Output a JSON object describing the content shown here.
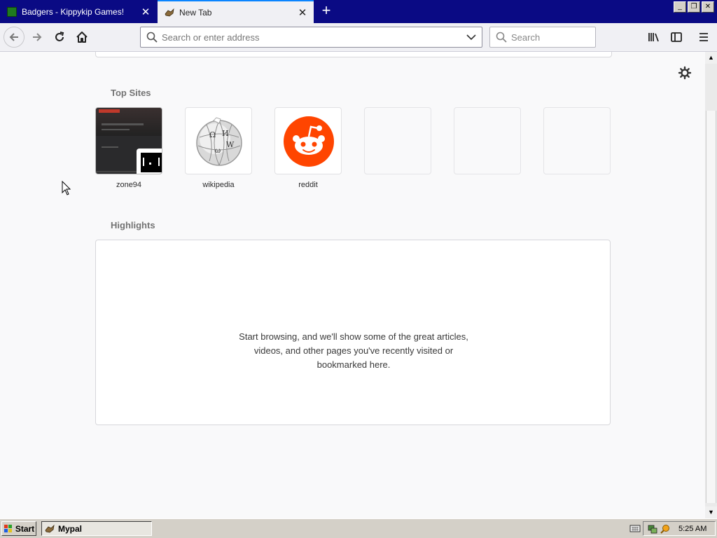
{
  "tabs": [
    {
      "title": "Badgers - Kippykip Games!",
      "active": false,
      "favicon": "green-square-favicon"
    },
    {
      "title": "New Tab",
      "active": true,
      "favicon": "mypal-favicon"
    }
  ],
  "newtab_icon": "plus-icon",
  "window_controls": [
    "minimize",
    "restore",
    "close"
  ],
  "navbar": {
    "url_placeholder": "Search or enter address",
    "search_placeholder": "Search"
  },
  "newtab": {
    "top_sites_title": "Top Sites",
    "top_sites": [
      {
        "label": "zone94",
        "type": "screenshot"
      },
      {
        "label": "wikipedia",
        "type": "icon"
      },
      {
        "label": "reddit",
        "type": "icon"
      },
      {
        "label": "",
        "type": "empty"
      },
      {
        "label": "",
        "type": "empty"
      },
      {
        "label": "",
        "type": "empty"
      }
    ],
    "highlights_title": "Highlights",
    "highlights_empty_line1": "Start browsing, and we'll show some of the great articles,",
    "highlights_empty_line2": "videos, and other pages you've recently visited or",
    "highlights_empty_line3": "bookmarked here."
  },
  "taskbar": {
    "start_label": "Start",
    "task_label": "Mypal",
    "clock": "5:25 AM"
  },
  "colors": {
    "titlebar": "#0a0a84",
    "reddit": "#ff4500",
    "accent": "#0a84ff"
  }
}
